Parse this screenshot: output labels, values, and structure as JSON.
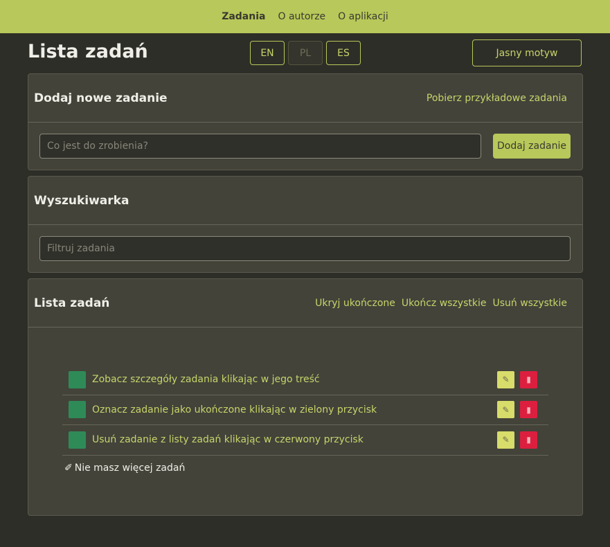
{
  "nav": {
    "items": [
      {
        "label": "Zadania",
        "active": true
      },
      {
        "label": "O autorze",
        "active": false
      },
      {
        "label": "O aplikacji",
        "active": false
      }
    ]
  },
  "header": {
    "title": "Lista zadań",
    "languages": [
      {
        "label": "EN",
        "active": false
      },
      {
        "label": "PL",
        "active": true
      },
      {
        "label": "ES",
        "active": false
      }
    ],
    "theme_button": "Jasny motyw"
  },
  "add_section": {
    "title": "Dodaj nowe zadanie",
    "sample_link": "Pobierz przykładowe zadania",
    "input_placeholder": "Co jest do zrobienia?",
    "input_value": "",
    "add_button": "Dodaj zadanie"
  },
  "search_section": {
    "title": "Wyszukiwarka",
    "input_placeholder": "Filtruj zadania",
    "input_value": ""
  },
  "list_section": {
    "title": "Lista zadań",
    "actions": {
      "hide_done": "Ukryj ukończone",
      "complete_all": "Ukończ wszystkie",
      "delete_all": "Usuń wszystkie"
    },
    "tasks": [
      {
        "text": "Zobacz szczegóły zadania klikając w jego treść"
      },
      {
        "text": "Oznacz zadanie jako ukończone klikając w zielony przycisk"
      },
      {
        "text": "Usuń zadanie z listy zadań klikając w czerwony przycisk"
      }
    ],
    "empty_icon": "✐",
    "empty_message": "Nie masz więcej zadań"
  },
  "colors": {
    "accent": "#b8c85a",
    "background": "#2e2e28",
    "card": "#43433a",
    "complete": "#2e8b57",
    "delete": "#dc1f3f",
    "edit": "#d8dc6a"
  },
  "icons": {
    "edit": "pencil-icon",
    "delete": "trash-icon",
    "empty": "pencil-icon"
  }
}
